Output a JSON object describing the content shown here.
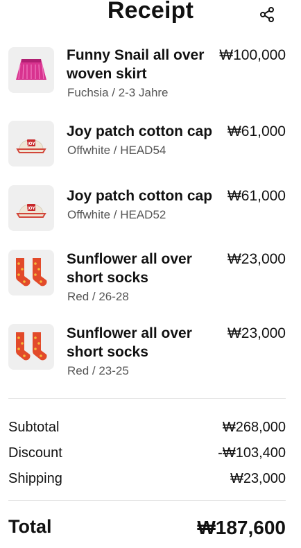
{
  "header": {
    "title": "Receipt",
    "share_icon": "share-icon"
  },
  "items": [
    {
      "name_line1": "Funny Snail all over",
      "name_line2": "woven skirt",
      "variant": "Fuchsia / 2-3 Jahre",
      "price": "₩100,000",
      "image": "fuchsia-skirt-image"
    },
    {
      "name_line1": "Joy patch cotton cap",
      "variant": "Offwhite / HEAD54",
      "price": "₩61,000",
      "image": "offwhite-cap-image"
    },
    {
      "name_line1": "Joy patch cotton cap",
      "variant": "Offwhite / HEAD52",
      "price": "₩61,000",
      "image": "offwhite-cap-image"
    },
    {
      "name_line1": "Sunflower all over",
      "name_line2": "short socks",
      "variant": "Red / 26-28",
      "price": "₩23,000",
      "image": "red-socks-image"
    },
    {
      "name_line1": "Sunflower all over",
      "name_line2": "short socks",
      "variant": "Red / 23-25",
      "price": "₩23,000",
      "image": "red-socks-image"
    }
  ],
  "summary": {
    "subtotal_label": "Subtotal",
    "subtotal_value": "₩268,000",
    "discount_label": "Discount",
    "discount_value": "-₩103,400",
    "shipping_label": "Shipping",
    "shipping_value": "₩23,000",
    "total_label": "Total",
    "total_value": "₩187,600"
  },
  "colors": {
    "text": "#111111",
    "muted": "#555555",
    "thumb_bg": "#efefef",
    "skirt": "#d8338f",
    "cap": "#efe6d6",
    "socks": "#e24a2a"
  }
}
